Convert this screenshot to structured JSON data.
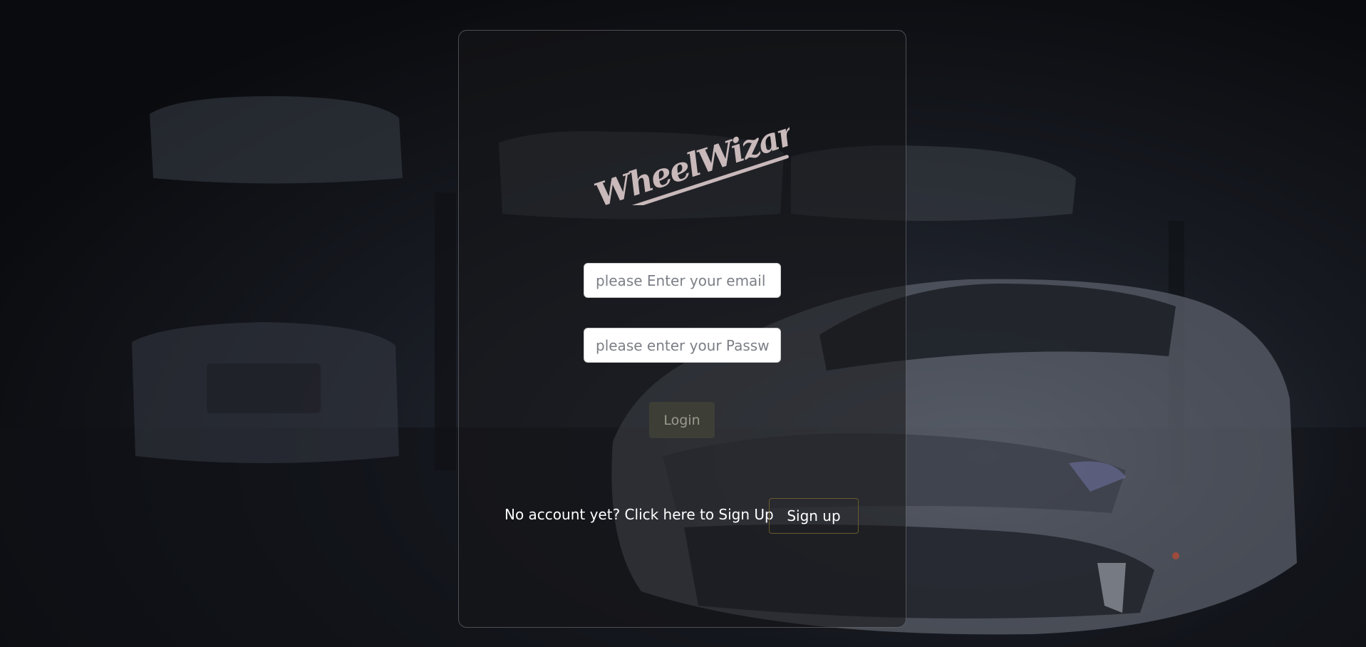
{
  "brand": {
    "logo_text": "WheelWizard",
    "logo_color": "#c9b9bb"
  },
  "login_form": {
    "email_placeholder": "please Enter your email",
    "email_value": "",
    "password_placeholder": "please enter your Password",
    "password_value": "",
    "login_label": "Login"
  },
  "signup": {
    "prompt_text": "No account yet? Click here to Sign Up",
    "button_label": "Sign up",
    "button_border_color": "#6b5a2c"
  },
  "background": {
    "subject": "dark garage with parked cars"
  }
}
